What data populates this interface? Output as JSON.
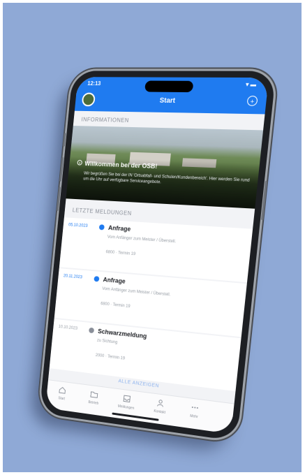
{
  "status_bar": {
    "time": "12:13",
    "icons": "▾ ▬"
  },
  "nav": {
    "title": "Start",
    "action_icon": "plus-circle-icon"
  },
  "info_section": {
    "header": "INFORMATIONEN",
    "hero_title": "Willkommen bei der OSB!",
    "hero_body": "Wir begrüßen Sie bei der IN 'Ortsabfall- und Schulen/Kundenbereich'. Hier werden Sie rund um die Uhr auf verfügbare Serviceangebote."
  },
  "messages_section": {
    "header": "LETZTE MELDUNGEN",
    "items": [
      {
        "date": "05.10.2023",
        "title": "Anfrage",
        "subtitle": "Vom Anfänger zum Meister / Überstell.",
        "meta": "6800 · Termin 19",
        "status_color": "#1f7bf0"
      },
      {
        "date": "20.11.2023",
        "title": "Anfrage",
        "subtitle": "Vom Anfänger zum Meister / Überstell.",
        "meta": "6800 · Termin 19",
        "status_color": "#1f7bf0"
      },
      {
        "date": "10.10.2023",
        "title": "Schwarzmeldung",
        "subtitle": "zu Sichtung",
        "meta": "2000 · Termin 19",
        "status_color": "#8a8f99"
      }
    ],
    "show_all": "ALLE ANZEIGEN"
  },
  "tabbar": {
    "tabs": [
      {
        "label": "Start",
        "icon": "home-icon"
      },
      {
        "label": "Betrieb",
        "icon": "folder-icon"
      },
      {
        "label": "Meldungen",
        "icon": "inbox-icon"
      },
      {
        "label": "Kontakt",
        "icon": "person-icon"
      },
      {
        "label": "Mehr",
        "icon": "more-icon"
      }
    ]
  },
  "colors": {
    "background": "#8fa9d6",
    "accent": "#1f7bf0"
  }
}
